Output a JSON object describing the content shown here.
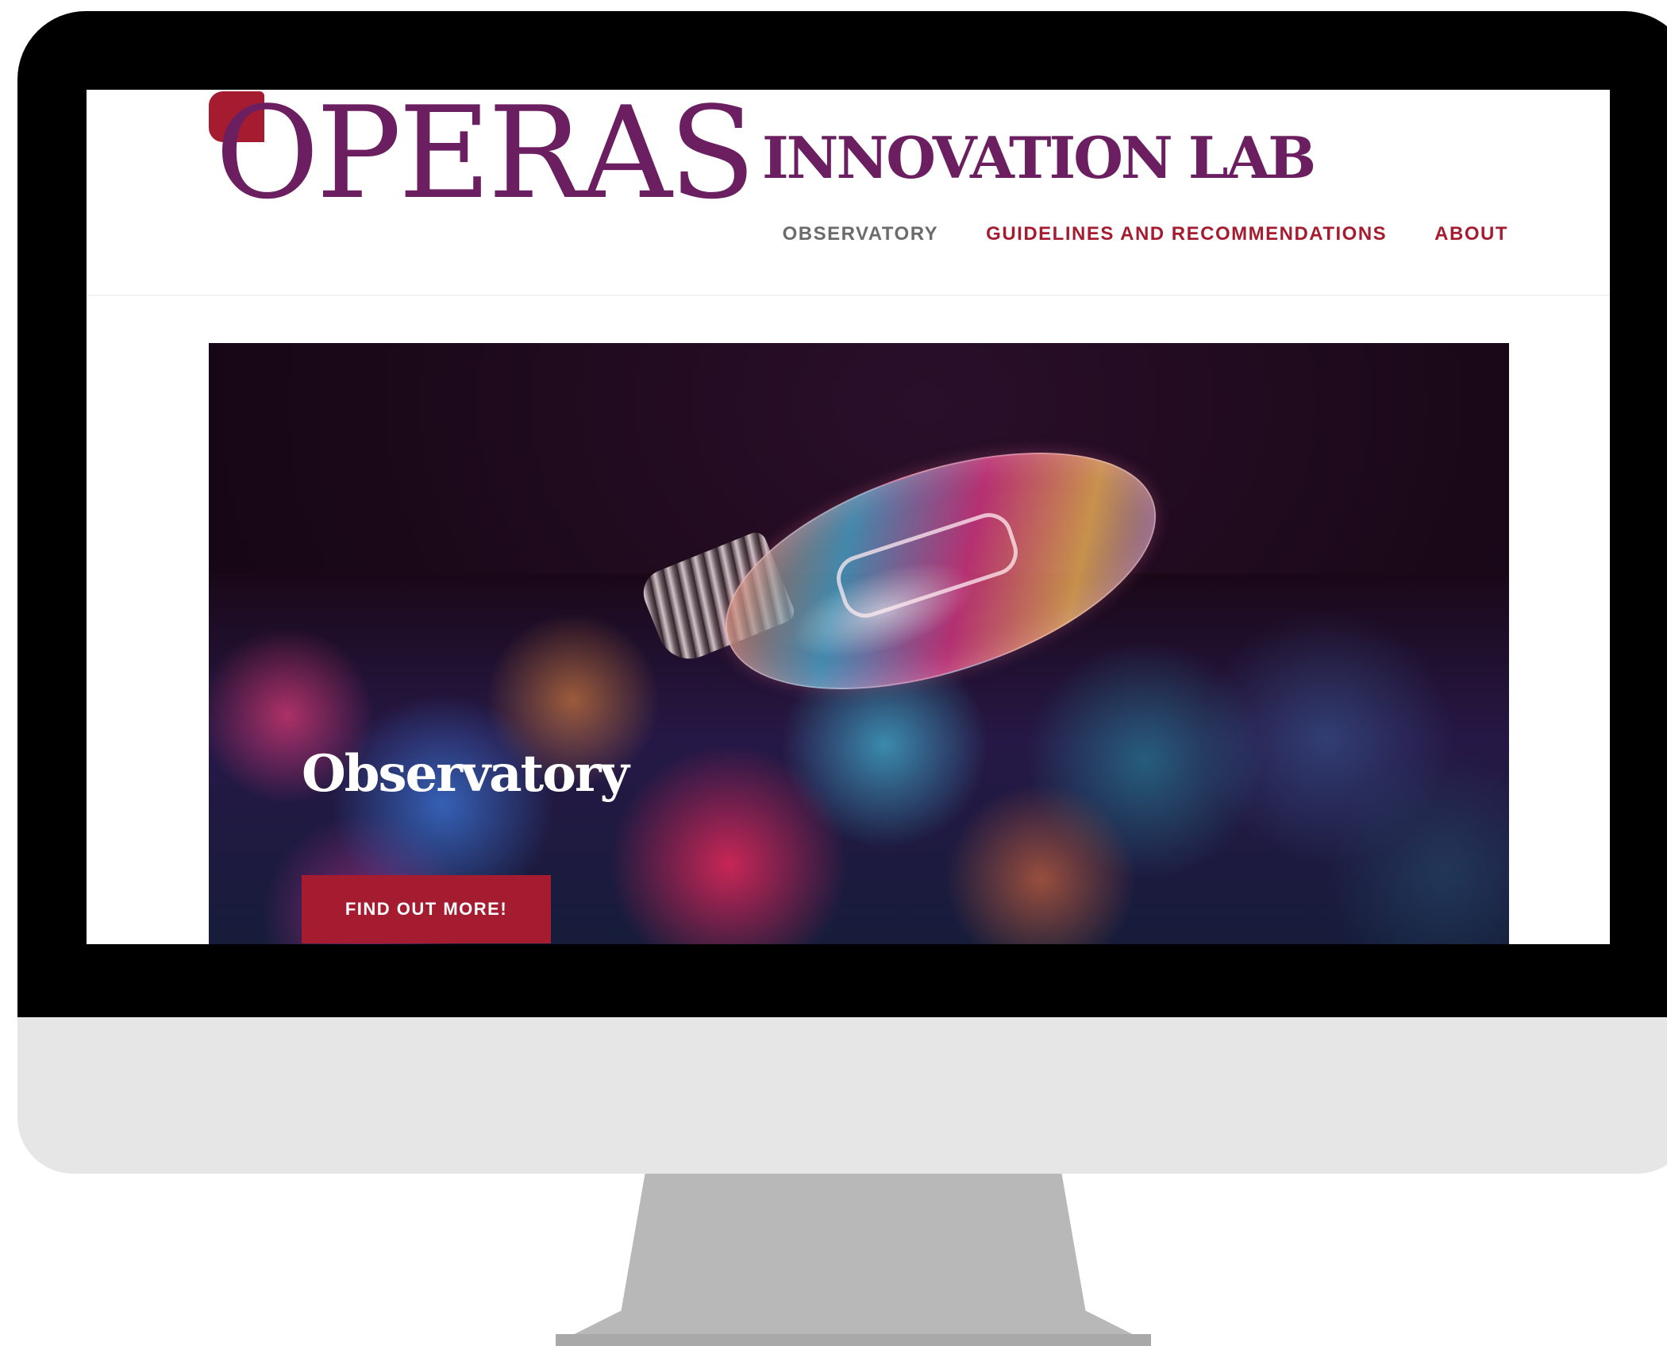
{
  "site": {
    "logo_word": "OPERAS",
    "logo_sub": "INNOVATION LAB"
  },
  "nav": {
    "items": [
      {
        "label": "OBSERVATORY",
        "active": false
      },
      {
        "label": "GUIDELINES AND RECOMMENDATIONS",
        "active": true
      },
      {
        "label": "ABOUT",
        "active": true
      }
    ]
  },
  "hero": {
    "title": "Observatory",
    "button_label": "FIND OUT MORE!"
  },
  "colors": {
    "brand_purple": "#6b1f61",
    "accent_red": "#a51c30",
    "nav_inactive": "#6b6b6b"
  }
}
